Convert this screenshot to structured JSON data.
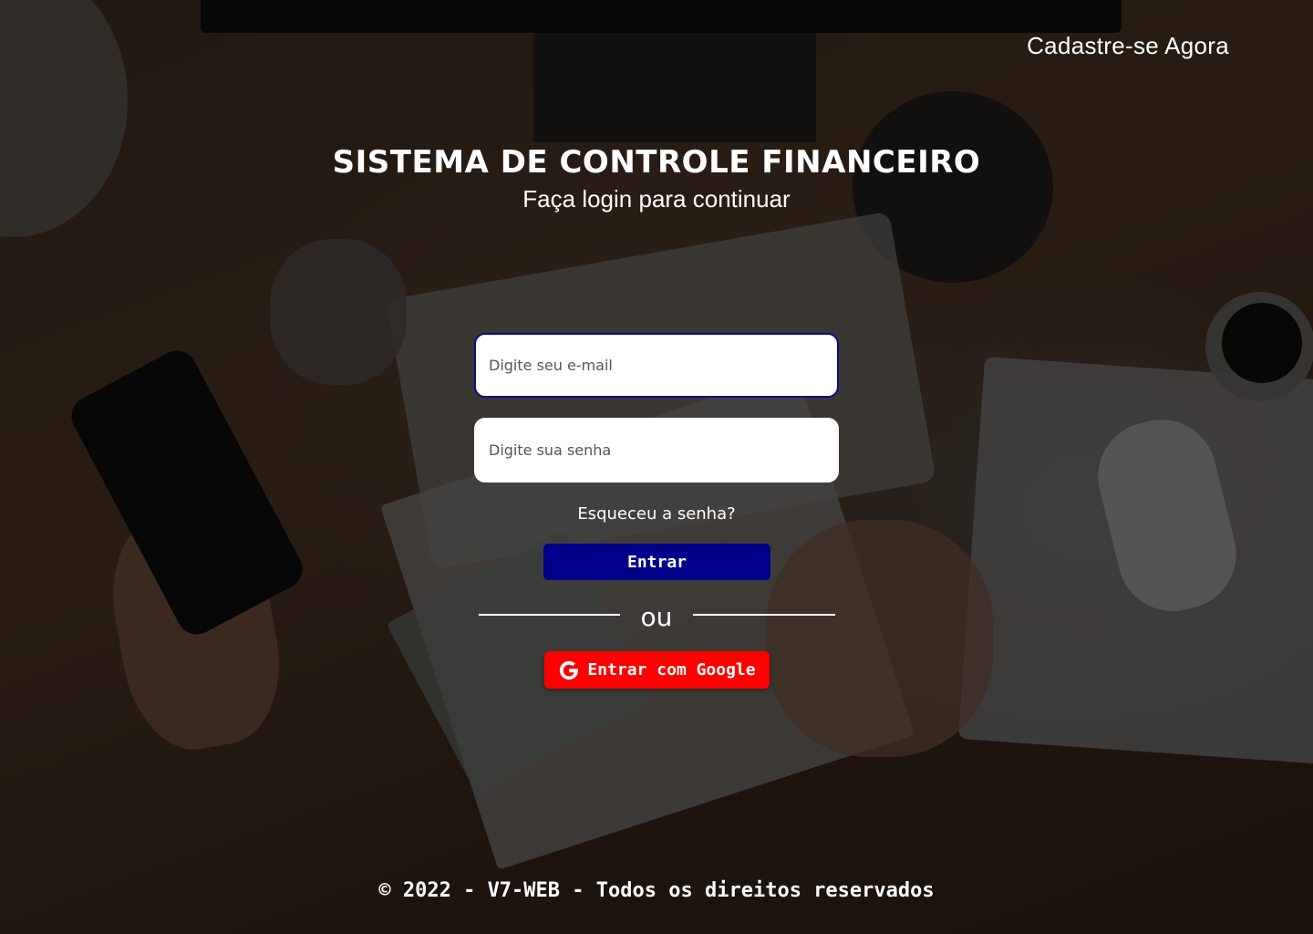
{
  "header": {
    "signup_link": "Cadastre-se Agora"
  },
  "hero": {
    "title": "SISTEMA DE CONTROLE FINANCEIRO",
    "subtitle": "Faça login para continuar"
  },
  "form": {
    "email_placeholder": "Digite seu e-mail",
    "email_value": "",
    "password_placeholder": "Digite sua senha",
    "password_value": "",
    "forgot_password": "Esqueceu a senha?",
    "submit_label": "Entrar",
    "divider_text": "ou",
    "google_label": "Entrar com Google",
    "google_icon": "google-g-icon"
  },
  "footer": {
    "text": "© 2022 - V7-WEB - Todos os direitos reservados"
  },
  "colors": {
    "primary_button": "#00008b",
    "google_button": "#ff0000",
    "focused_input_border": "#0a0a8a",
    "text": "#ffffff"
  }
}
